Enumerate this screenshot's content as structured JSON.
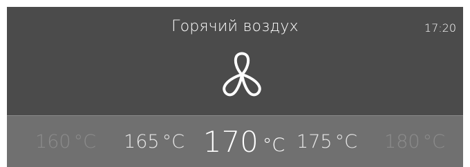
{
  "header": {
    "mode_title": "Горячий воздух",
    "clock": "17:20",
    "mode_icon": "fan-icon"
  },
  "temperature_selector": {
    "unit": "°C",
    "options": [
      {
        "value": "160",
        "state": "far"
      },
      {
        "value": "165",
        "state": "near"
      },
      {
        "value": "170",
        "state": "selected"
      },
      {
        "value": "175",
        "state": "near"
      },
      {
        "value": "180",
        "state": "far"
      }
    ],
    "selected_value": "170"
  },
  "colors": {
    "header_bg": "#4b4b4b",
    "selector_bg": "#707070",
    "text_primary": "#ffffff",
    "text_dim": "#8c8c8c"
  }
}
